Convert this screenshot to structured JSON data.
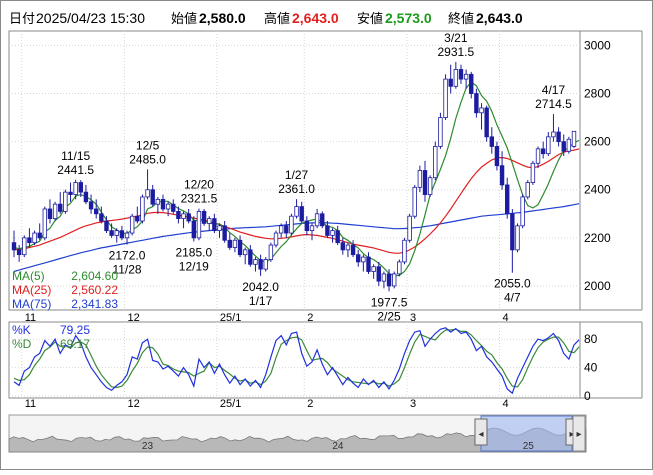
{
  "header": {
    "date_label": "日付",
    "datetime": "2025/04/23 15:30",
    "open_label": "始値",
    "open": "2,580.0",
    "high_label": "高値",
    "high": "2,643.0",
    "low_label": "安値",
    "low": "2,573.0",
    "close_label": "終値",
    "close": "2,643.0"
  },
  "colors": {
    "up": "#ffffff",
    "down": "#1c1ca0",
    "ma5": "#2e8b2e",
    "ma25": "#e02020",
    "ma75": "#2040d0",
    "k": "#2030e0",
    "d": "#3a8a3a",
    "high_value": "#e02020",
    "low_value": "#1a9a1a"
  },
  "main_legend": [
    {
      "label": "MA(5)",
      "value": "2,604.60",
      "color": "#2e8b2e"
    },
    {
      "label": "MA(25)",
      "value": "2,560.22",
      "color": "#e02020"
    },
    {
      "label": "MA(75)",
      "value": "2,341.83",
      "color": "#2040d0"
    }
  ],
  "stoch_legend": [
    {
      "label": "%K",
      "value": "79.25",
      "color": "#2030e0"
    },
    {
      "label": "%D",
      "value": "69.17",
      "color": "#3a8a3a"
    }
  ],
  "main_ticks": [
    "3000",
    "2800",
    "2600",
    "2400",
    "2200",
    "2000"
  ],
  "main_tick_values": [
    3000,
    2800,
    2600,
    2400,
    2200,
    2000
  ],
  "stoch_ticks": [
    "80",
    "40",
    "0"
  ],
  "stoch_tick_values": [
    80,
    40,
    0
  ],
  "month_labels": [
    {
      "text": "11",
      "i": 2
    },
    {
      "text": "12",
      "i": 22
    },
    {
      "text": "25/1",
      "i": 40
    },
    {
      "text": "2",
      "i": 57
    },
    {
      "text": "3",
      "i": 77
    },
    {
      "text": "4",
      "i": 95
    }
  ],
  "navigator": {
    "labels": [
      {
        "text": "23",
        "frac": 0.24
      },
      {
        "text": "24",
        "frac": 0.57
      },
      {
        "text": "25",
        "frac": 0.9
      }
    ],
    "window_start_frac": 0.818,
    "window_end_frac": 1.0
  },
  "annotations": [
    {
      "lines": [
        "11/15",
        "2441.5"
      ],
      "i": 12,
      "value": 2441.5,
      "pos": "above"
    },
    {
      "lines": [
        "12/5",
        "2485.0"
      ],
      "i": 26,
      "value": 2485.0,
      "pos": "above"
    },
    {
      "lines": [
        "12/20",
        "2321.5"
      ],
      "i": 36,
      "value": 2321.5,
      "pos": "above"
    },
    {
      "lines": [
        "1/27",
        "2361.0"
      ],
      "i": 55,
      "value": 2361.0,
      "pos": "above"
    },
    {
      "lines": [
        "3/21",
        "2931.5"
      ],
      "i": 86,
      "value": 2931.5,
      "pos": "above"
    },
    {
      "lines": [
        "4/17",
        "2714.5"
      ],
      "i": 105,
      "value": 2714.5,
      "pos": "above"
    },
    {
      "lines": [
        "2172.0",
        "11/28"
      ],
      "i": 22,
      "value": 2172.0,
      "pos": "below"
    },
    {
      "lines": [
        "2185.0",
        "12/19"
      ],
      "i": 35,
      "value": 2185.0,
      "pos": "below"
    },
    {
      "lines": [
        "2042.0",
        "1/17"
      ],
      "i": 48,
      "value": 2042.0,
      "pos": "below"
    },
    {
      "lines": [
        "1977.5",
        "2/25"
      ],
      "i": 73,
      "value": 1977.5,
      "pos": "below"
    },
    {
      "lines": [
        "2055.0",
        "4/7"
      ],
      "i": 97,
      "value": 2055.0,
      "pos": "below"
    }
  ],
  "chart_data": {
    "type": "candlestick",
    "title": "",
    "xlabel": "",
    "ylabel": "",
    "ylim": [
      1900,
      3060
    ],
    "stoch_ylim": [
      0,
      100
    ],
    "grid": true,
    "legend": "top-left",
    "candles": [
      [
        2180,
        2230,
        2120,
        2150
      ],
      [
        2150,
        2170,
        2100,
        2130
      ],
      [
        2130,
        2210,
        2120,
        2200
      ],
      [
        2200,
        2240,
        2160,
        2180
      ],
      [
        2180,
        2230,
        2170,
        2220
      ],
      [
        2220,
        2260,
        2190,
        2200
      ],
      [
        2200,
        2330,
        2190,
        2320
      ],
      [
        2320,
        2360,
        2260,
        2280
      ],
      [
        2280,
        2350,
        2270,
        2340
      ],
      [
        2340,
        2390,
        2300,
        2310
      ],
      [
        2310,
        2400,
        2300,
        2390
      ],
      [
        2390,
        2430,
        2350,
        2380
      ],
      [
        2380,
        2441.5,
        2360,
        2430
      ],
      [
        2430,
        2440,
        2370,
        2390
      ],
      [
        2390,
        2420,
        2340,
        2350
      ],
      [
        2350,
        2380,
        2300,
        2320
      ],
      [
        2320,
        2360,
        2280,
        2300
      ],
      [
        2300,
        2330,
        2260,
        2270
      ],
      [
        2270,
        2290,
        2220,
        2230
      ],
      [
        2230,
        2260,
        2200,
        2210
      ],
      [
        2210,
        2240,
        2180,
        2230
      ],
      [
        2230,
        2250,
        2190,
        2200
      ],
      [
        2200,
        2230,
        2172,
        2220
      ],
      [
        2220,
        2300,
        2210,
        2290
      ],
      [
        2290,
        2330,
        2260,
        2270
      ],
      [
        2270,
        2380,
        2260,
        2370
      ],
      [
        2370,
        2485,
        2360,
        2400
      ],
      [
        2400,
        2420,
        2330,
        2340
      ],
      [
        2340,
        2370,
        2300,
        2360
      ],
      [
        2360,
        2380,
        2310,
        2320
      ],
      [
        2320,
        2350,
        2290,
        2340
      ],
      [
        2340,
        2360,
        2300,
        2310
      ],
      [
        2310,
        2330,
        2260,
        2280
      ],
      [
        2280,
        2310,
        2240,
        2300
      ],
      [
        2300,
        2320,
        2260,
        2270
      ],
      [
        2270,
        2290,
        2185,
        2200
      ],
      [
        2200,
        2321.5,
        2190,
        2310
      ],
      [
        2310,
        2320,
        2250,
        2260
      ],
      [
        2260,
        2290,
        2230,
        2280
      ],
      [
        2280,
        2300,
        2220,
        2230
      ],
      [
        2230,
        2260,
        2200,
        2250
      ],
      [
        2250,
        2270,
        2180,
        2190
      ],
      [
        2190,
        2220,
        2150,
        2160
      ],
      [
        2160,
        2200,
        2140,
        2190
      ],
      [
        2190,
        2210,
        2120,
        2130
      ],
      [
        2130,
        2160,
        2090,
        2150
      ],
      [
        2150,
        2170,
        2080,
        2090
      ],
      [
        2090,
        2120,
        2060,
        2110
      ],
      [
        2110,
        2130,
        2042,
        2070
      ],
      [
        2070,
        2120,
        2060,
        2110
      ],
      [
        2110,
        2180,
        2100,
        2170
      ],
      [
        2170,
        2230,
        2160,
        2220
      ],
      [
        2220,
        2260,
        2200,
        2250
      ],
      [
        2250,
        2270,
        2200,
        2220
      ],
      [
        2220,
        2300,
        2210,
        2290
      ],
      [
        2290,
        2361,
        2280,
        2330
      ],
      [
        2330,
        2350,
        2260,
        2270
      ],
      [
        2270,
        2290,
        2210,
        2230
      ],
      [
        2230,
        2260,
        2190,
        2250
      ],
      [
        2250,
        2320,
        2240,
        2300
      ],
      [
        2300,
        2310,
        2240,
        2250
      ],
      [
        2250,
        2270,
        2200,
        2210
      ],
      [
        2210,
        2240,
        2180,
        2230
      ],
      [
        2230,
        2250,
        2170,
        2180
      ],
      [
        2180,
        2200,
        2130,
        2150
      ],
      [
        2150,
        2180,
        2120,
        2170
      ],
      [
        2170,
        2190,
        2120,
        2130
      ],
      [
        2130,
        2150,
        2080,
        2100
      ],
      [
        2100,
        2130,
        2060,
        2120
      ],
      [
        2120,
        2140,
        2050,
        2060
      ],
      [
        2060,
        2090,
        2030,
        2080
      ],
      [
        2080,
        2100,
        2000,
        2020
      ],
      [
        2020,
        2060,
        1990,
        2050
      ],
      [
        2050,
        2070,
        1977.5,
        2000
      ],
      [
        2000,
        2060,
        1990,
        2050
      ],
      [
        2050,
        2110,
        2040,
        2100
      ],
      [
        2100,
        2200,
        2090,
        2190
      ],
      [
        2190,
        2300,
        2180,
        2290
      ],
      [
        2290,
        2420,
        2280,
        2410
      ],
      [
        2410,
        2500,
        2390,
        2480
      ],
      [
        2480,
        2520,
        2350,
        2380
      ],
      [
        2380,
        2460,
        2370,
        2450
      ],
      [
        2450,
        2600,
        2440,
        2580
      ],
      [
        2580,
        2720,
        2570,
        2700
      ],
      [
        2700,
        2880,
        2690,
        2860
      ],
      [
        2860,
        2920,
        2800,
        2830
      ],
      [
        2830,
        2931.5,
        2820,
        2900
      ],
      [
        2900,
        2920,
        2840,
        2860
      ],
      [
        2860,
        2900,
        2820,
        2880
      ],
      [
        2880,
        2890,
        2780,
        2800
      ],
      [
        2800,
        2820,
        2700,
        2720
      ],
      [
        2720,
        2760,
        2650,
        2740
      ],
      [
        2740,
        2750,
        2600,
        2620
      ],
      [
        2620,
        2660,
        2550,
        2580
      ],
      [
        2580,
        2600,
        2480,
        2500
      ],
      [
        2500,
        2560,
        2400,
        2420
      ],
      [
        2420,
        2450,
        2280,
        2300
      ],
      [
        2300,
        2320,
        2055,
        2150
      ],
      [
        2150,
        2260,
        2140,
        2250
      ],
      [
        2250,
        2380,
        2240,
        2370
      ],
      [
        2370,
        2440,
        2360,
        2430
      ],
      [
        2430,
        2520,
        2420,
        2510
      ],
      [
        2510,
        2580,
        2490,
        2570
      ],
      [
        2570,
        2600,
        2530,
        2550
      ],
      [
        2550,
        2640,
        2540,
        2620
      ],
      [
        2620,
        2714.5,
        2600,
        2640
      ],
      [
        2640,
        2660,
        2580,
        2600
      ],
      [
        2600,
        2630,
        2540,
        2560
      ],
      [
        2560,
        2620,
        2550,
        2610
      ],
      [
        2580,
        2643,
        2573,
        2643
      ]
    ],
    "ma5": [
      2160,
      2155,
      2160,
      2165,
      2176,
      2186,
      2224,
      2240,
      2272,
      2290,
      2328,
      2344,
      2374,
      2380,
      2372,
      2358,
      2340,
      2308,
      2274,
      2246,
      2232,
      2218,
      2218,
      2234,
      2246,
      2270,
      2320,
      2330,
      2350,
      2352,
      2352,
      2336,
      2322,
      2312,
      2300,
      2272,
      2272,
      2270,
      2264,
      2256,
      2258,
      2242,
      2222,
      2206,
      2184,
      2168,
      2146,
      2124,
      2106,
      2100,
      2112,
      2138,
      2164,
      2184,
      2212,
      2238,
      2260,
      2268,
      2274,
      2278,
      2266,
      2248,
      2244,
      2230,
      2202,
      2190,
      2172,
      2158,
      2134,
      2118,
      2110,
      2094,
      2074,
      2052,
      2042,
      2044,
      2060,
      2092,
      2146,
      2216,
      2296,
      2378,
      2432,
      2484,
      2542,
      2614,
      2696,
      2764,
      2822,
      2848,
      2832,
      2792,
      2768,
      2726,
      2670,
      2622,
      2574,
      2510,
      2442,
      2380,
      2334,
      2324,
      2338,
      2380,
      2424,
      2476,
      2524,
      2562,
      2576,
      2595,
      2605
    ],
    "ma25": [
      2150,
      2152,
      2155,
      2160,
      2165,
      2170,
      2178,
      2186,
      2194,
      2202,
      2212,
      2222,
      2232,
      2242,
      2250,
      2256,
      2262,
      2266,
      2270,
      2272,
      2275,
      2278,
      2282,
      2286,
      2290,
      2296,
      2302,
      2305,
      2306,
      2305,
      2302,
      2298,
      2294,
      2290,
      2286,
      2282,
      2278,
      2274,
      2268,
      2262,
      2256,
      2248,
      2240,
      2232,
      2224,
      2218,
      2212,
      2206,
      2202,
      2198,
      2196,
      2196,
      2198,
      2200,
      2204,
      2208,
      2212,
      2214,
      2212,
      2210,
      2206,
      2202,
      2198,
      2192,
      2186,
      2180,
      2174,
      2170,
      2166,
      2162,
      2158,
      2152,
      2146,
      2140,
      2136,
      2136,
      2140,
      2150,
      2162,
      2178,
      2196,
      2216,
      2238,
      2262,
      2290,
      2320,
      2352,
      2384,
      2416,
      2446,
      2472,
      2494,
      2510,
      2524,
      2532,
      2534,
      2530,
      2522,
      2512,
      2502,
      2494,
      2492,
      2496,
      2506,
      2518,
      2532,
      2546,
      2556,
      2562,
      2565,
      2570
    ],
    "ma75": [
      2060,
      2066,
      2072,
      2078,
      2084,
      2090,
      2096,
      2102,
      2108,
      2114,
      2120,
      2126,
      2132,
      2138,
      2143,
      2148,
      2153,
      2158,
      2162,
      2166,
      2170,
      2174,
      2178,
      2182,
      2186,
      2190,
      2194,
      2198,
      2202,
      2206,
      2209,
      2212,
      2215,
      2218,
      2221,
      2224,
      2226,
      2228,
      2230,
      2232,
      2234,
      2236,
      2238,
      2240,
      2241,
      2242,
      2243,
      2244,
      2245,
      2246,
      2248,
      2250,
      2252,
      2254,
      2256,
      2258,
      2260,
      2261,
      2262,
      2263,
      2263,
      2262,
      2261,
      2260,
      2258,
      2256,
      2254,
      2252,
      2250,
      2248,
      2246,
      2244,
      2242,
      2240,
      2238,
      2238,
      2239,
      2240,
      2242,
      2244,
      2247,
      2250,
      2254,
      2258,
      2262,
      2266,
      2270,
      2274,
      2278,
      2282,
      2286,
      2290,
      2292,
      2294,
      2296,
      2298,
      2300,
      2302,
      2304,
      2306,
      2309,
      2312,
      2315,
      2318,
      2321,
      2324,
      2327,
      2330,
      2334,
      2338,
      2342
    ],
    "stoch_k": [
      20,
      15,
      35,
      40,
      55,
      60,
      78,
      70,
      80,
      60,
      72,
      68,
      85,
      75,
      55,
      40,
      30,
      20,
      12,
      8,
      15,
      20,
      30,
      55,
      52,
      75,
      80,
      50,
      48,
      38,
      42,
      35,
      28,
      40,
      30,
      14,
      52,
      40,
      48,
      32,
      45,
      30,
      18,
      28,
      16,
      24,
      14,
      22,
      12,
      30,
      55,
      78,
      85,
      72,
      88,
      90,
      60,
      42,
      48,
      65,
      45,
      30,
      40,
      28,
      16,
      26,
      18,
      12,
      24,
      16,
      22,
      12,
      20,
      10,
      22,
      38,
      60,
      78,
      90,
      92,
      70,
      80,
      88,
      94,
      96,
      90,
      95,
      88,
      90,
      80,
      64,
      70,
      55,
      48,
      38,
      28,
      10,
      4,
      25,
      40,
      55,
      70,
      80,
      78,
      82,
      88,
      78,
      60,
      52,
      72,
      79.25
    ],
    "stoch_d": [
      25,
      22,
      23,
      30,
      43,
      52,
      64,
      69,
      76,
      70,
      71,
      67,
      75,
      76,
      72,
      57,
      42,
      30,
      21,
      13,
      12,
      14,
      22,
      35,
      46,
      61,
      69,
      68,
      59,
      45,
      43,
      38,
      35,
      34,
      33,
      28,
      32,
      35,
      47,
      40,
      42,
      36,
      31,
      25,
      21,
      23,
      18,
      20,
      16,
      21,
      32,
      54,
      73,
      78,
      82,
      83,
      79,
      64,
      50,
      52,
      53,
      47,
      38,
      33,
      28,
      23,
      20,
      19,
      18,
      17,
      20,
      17,
      18,
      14,
      17,
      23,
      40,
      59,
      76,
      87,
      84,
      81,
      79,
      87,
      93,
      93,
      94,
      91,
      91,
      86,
      78,
      71,
      63,
      58,
      47,
      38,
      25,
      14,
      13,
      23,
      40,
      55,
      68,
      76,
      80,
      83,
      83,
      75,
      63,
      61,
      69.17
    ]
  }
}
